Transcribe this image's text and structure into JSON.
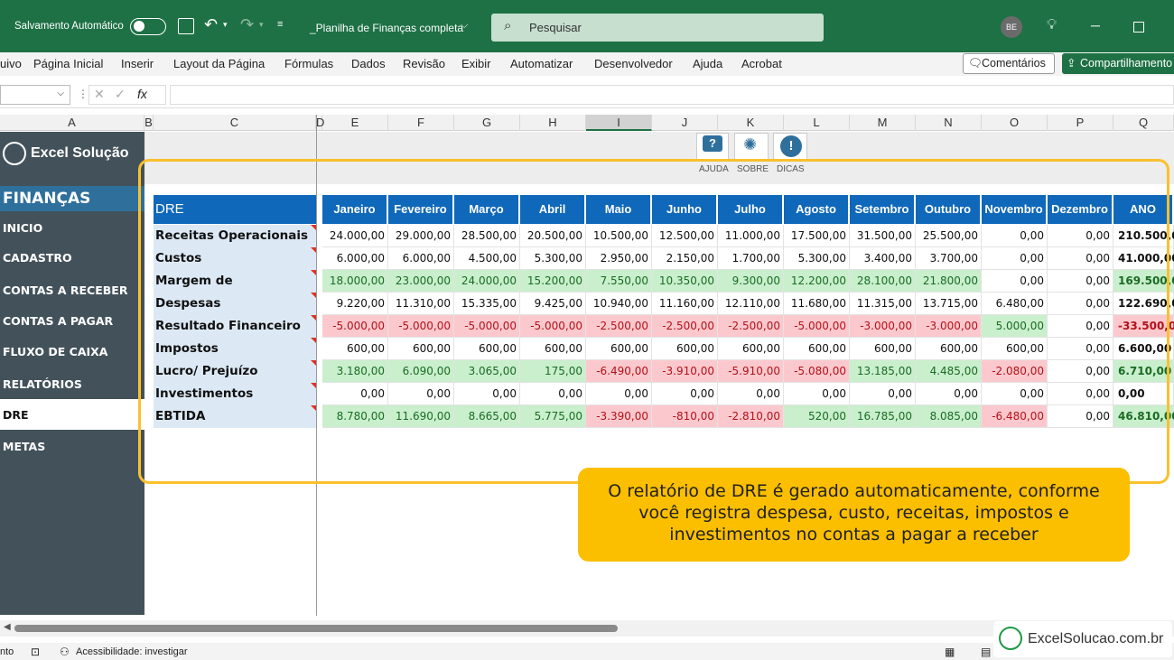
{
  "titlebar": {
    "autosave": "Salvamento Automático",
    "filename": "_Planilha de Finanças completa",
    "search_placeholder": "Pesquisar",
    "avatar": "BE"
  },
  "menu": [
    "uivo",
    "Página Inicial",
    "Inserir",
    "Layout da Página",
    "Fórmulas",
    "Dados",
    "Revisão",
    "Exibir",
    "Automatizar",
    "Desenvolvedor",
    "Ajuda",
    "Acrobat"
  ],
  "buttons": {
    "comments": "Comentários",
    "share": "Compartilhamento"
  },
  "formula": {
    "fx": "fx"
  },
  "columns": [
    "A",
    "B",
    "C",
    "D",
    "E",
    "F",
    "G",
    "H",
    "I",
    "J",
    "K",
    "L",
    "M",
    "N",
    "O",
    "P",
    "Q"
  ],
  "sidebar": {
    "logo": "Excel Solução",
    "section": "FINANÇAS",
    "items": [
      "INICIO",
      "CADASTRO",
      "CONTAS A RECEBER",
      "CONTAS A PAGAR",
      "FLUXO DE CAIXA",
      "RELATÓRIOS",
      "DRE",
      "METAS"
    ],
    "active": "DRE"
  },
  "toolbar": {
    "help": "AJUDA",
    "about": "SOBRE",
    "tips": "DICAS"
  },
  "table": {
    "title": "DRE",
    "months": [
      "Janeiro",
      "Fevereiro",
      "Março",
      "Abril",
      "Maio",
      "Junho",
      "Julho",
      "Agosto",
      "Setembro",
      "Outubro",
      "Novembro",
      "Dezembro",
      "ANO"
    ],
    "rows": [
      {
        "label": "Receitas Operacionais",
        "style": "neu",
        "values": [
          "24.000,00",
          "29.000,00",
          "28.500,00",
          "20.500,00",
          "10.500,00",
          "12.500,00",
          "11.000,00",
          "17.500,00",
          "31.500,00",
          "25.500,00",
          "0,00",
          "0,00",
          "210.500,00"
        ],
        "classes": [
          "neu",
          "neu",
          "neu",
          "neu",
          "neu",
          "neu",
          "neu",
          "neu",
          "neu",
          "neu",
          "neu",
          "neu",
          "neu"
        ]
      },
      {
        "label": "Custos",
        "values": [
          "6.000,00",
          "6.000,00",
          "4.500,00",
          "5.300,00",
          "2.950,00",
          "2.150,00",
          "1.700,00",
          "5.300,00",
          "3.400,00",
          "3.700,00",
          "0,00",
          "0,00",
          "41.000,00"
        ],
        "classes": [
          "neu",
          "neu",
          "neu",
          "neu",
          "neu",
          "neu",
          "neu",
          "neu",
          "neu",
          "neu",
          "neu",
          "neu",
          "neu"
        ]
      },
      {
        "label": "Margem de Contribuição",
        "values": [
          "18.000,00",
          "23.000,00",
          "24.000,00",
          "15.200,00",
          "7.550,00",
          "10.350,00",
          "9.300,00",
          "12.200,00",
          "28.100,00",
          "21.800,00",
          "0,00",
          "0,00",
          "169.500,00"
        ],
        "classes": [
          "pos",
          "pos",
          "pos",
          "pos",
          "pos",
          "pos",
          "pos",
          "pos",
          "pos",
          "pos",
          "neu",
          "neu",
          "pos"
        ]
      },
      {
        "label": "Despesas",
        "values": [
          "9.220,00",
          "11.310,00",
          "15.335,00",
          "9.425,00",
          "10.940,00",
          "11.160,00",
          "12.110,00",
          "11.680,00",
          "11.315,00",
          "13.715,00",
          "6.480,00",
          "0,00",
          "122.690,00"
        ],
        "classes": [
          "neu",
          "neu",
          "neu",
          "neu",
          "neu",
          "neu",
          "neu",
          "neu",
          "neu",
          "neu",
          "neu",
          "neu",
          "neu"
        ]
      },
      {
        "label": "Resultado Financeiro",
        "values": [
          "-5.000,00",
          "-5.000,00",
          "-5.000,00",
          "-5.000,00",
          "-2.500,00",
          "-2.500,00",
          "-2.500,00",
          "-5.000,00",
          "-3.000,00",
          "-3.000,00",
          "5.000,00",
          "0,00",
          "-33.500,00"
        ],
        "classes": [
          "neg",
          "neg",
          "neg",
          "neg",
          "neg",
          "neg",
          "neg",
          "neg",
          "neg",
          "neg",
          "pos",
          "neu",
          "neg"
        ]
      },
      {
        "label": "Impostos",
        "values": [
          "600,00",
          "600,00",
          "600,00",
          "600,00",
          "600,00",
          "600,00",
          "600,00",
          "600,00",
          "600,00",
          "600,00",
          "600,00",
          "0,00",
          "6.600,00"
        ],
        "classes": [
          "neu",
          "neu",
          "neu",
          "neu",
          "neu",
          "neu",
          "neu",
          "neu",
          "neu",
          "neu",
          "neu",
          "neu",
          "neu"
        ]
      },
      {
        "label": "Lucro/ Prejuízo",
        "values": [
          "3.180,00",
          "6.090,00",
          "3.065,00",
          "175,00",
          "-6.490,00",
          "-3.910,00",
          "-5.910,00",
          "-5.080,00",
          "13.185,00",
          "4.485,00",
          "-2.080,00",
          "0,00",
          "6.710,00"
        ],
        "classes": [
          "pos",
          "pos",
          "pos",
          "pos",
          "neg",
          "neg",
          "neg",
          "neg",
          "pos",
          "pos",
          "neg",
          "neu",
          "pos"
        ]
      },
      {
        "label": "Investimentos",
        "values": [
          "0,00",
          "0,00",
          "0,00",
          "0,00",
          "0,00",
          "0,00",
          "0,00",
          "0,00",
          "0,00",
          "0,00",
          "0,00",
          "0,00",
          "0,00"
        ],
        "classes": [
          "neu",
          "neu",
          "neu",
          "neu",
          "neu",
          "neu",
          "neu",
          "neu",
          "neu",
          "neu",
          "neu",
          "neu",
          "neu"
        ]
      },
      {
        "label": "EBTIDA",
        "values": [
          "8.780,00",
          "11.690,00",
          "8.665,00",
          "5.775,00",
          "-3.390,00",
          "-810,00",
          "-2.810,00",
          "520,00",
          "16.785,00",
          "8.085,00",
          "-6.480,00",
          "0,00",
          "46.810,00"
        ],
        "classes": [
          "pos",
          "pos",
          "pos",
          "pos",
          "neg",
          "neg",
          "neg",
          "pos",
          "pos",
          "pos",
          "neg",
          "neu",
          "pos"
        ]
      }
    ]
  },
  "callout": "O relatório de DRE é gerado automaticamente, conforme você registra despesa, custo, receitas, impostos e investimentos no contas a pagar a receber",
  "status": {
    "left": "nto",
    "accessibility": "Acessibilidade: investigar"
  },
  "brand": "ExcelSolucao.com.br",
  "colors": {
    "excel_green": "#1e7145",
    "header_blue": "#1068ba",
    "sidebar": "#43525a",
    "highlight": "#fbbf00"
  }
}
